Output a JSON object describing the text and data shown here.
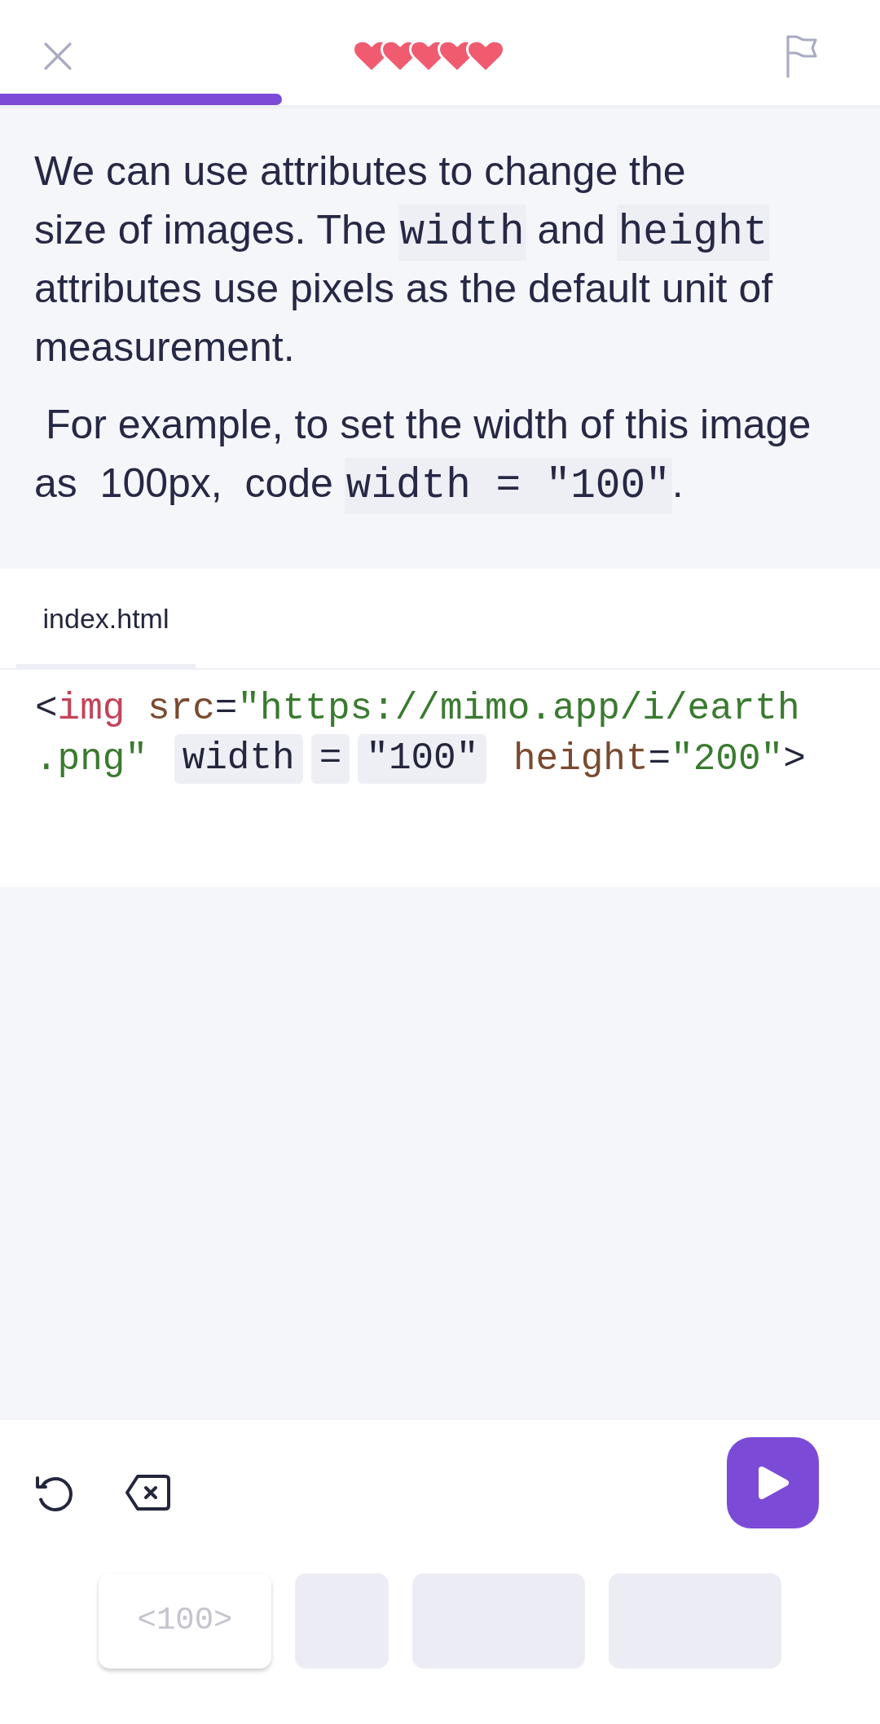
{
  "top_bar": {
    "progress": {
      "level": 0.32
    },
    "lives": [
      {
        "filled": true
      },
      {
        "filled": true
      },
      {
        "filled": true
      },
      {
        "filled": true
      },
      {
        "filled": true
      }
    ]
  },
  "lesson": {
    "paragraphs": [
      {
        "segments": [
          {
            "kind": "text",
            "text": "We can use attributes to change the\nsize of images. The "
          },
          {
            "kind": "code",
            "text": "width"
          },
          {
            "kind": "text",
            "text": " and "
          },
          {
            "kind": "code",
            "text": "height"
          },
          {
            "kind": "text",
            "text": " attributes use pixels as the default unit of measurement."
          }
        ]
      },
      {
        "segments": [
          {
            "kind": "text",
            "text": " For example, to set the width of this image as  100px,  code "
          },
          {
            "kind": "code",
            "text": "width = \"100\""
          },
          {
            "kind": "text",
            "text": "."
          }
        ]
      }
    ]
  },
  "editor": {
    "tabs": [
      {
        "label": "index.html",
        "selected": true
      }
    ],
    "code_lines": [
      {
        "tokens": [
          {
            "kind": "punct",
            "text": "<"
          },
          {
            "kind": "tag",
            "text": "img"
          },
          {
            "kind": "attr",
            "text": " src"
          },
          {
            "kind": "punct",
            "text": "="
          },
          {
            "kind": "string",
            "text": "\"https://mimo.app/i/earth"
          }
        ]
      },
      {
        "tokens": [
          {
            "kind": "string",
            "text": ".png\" "
          },
          {
            "kind": "slot",
            "text": "width"
          },
          {
            "kind": "slot",
            "text": "="
          },
          {
            "kind": "slot",
            "text": "\"100\""
          },
          {
            "kind": "attr",
            "text": " height"
          },
          {
            "kind": "punct",
            "text": "="
          },
          {
            "kind": "string",
            "text": "\"200\""
          },
          {
            "kind": "punct",
            "text": ">"
          }
        ]
      }
    ]
  },
  "answer_bank": {
    "disabled": true,
    "options": [
      {
        "label": "<100>",
        "used": false
      },
      {
        "used": true
      },
      {
        "used": true
      },
      {
        "used": true
      }
    ]
  }
}
